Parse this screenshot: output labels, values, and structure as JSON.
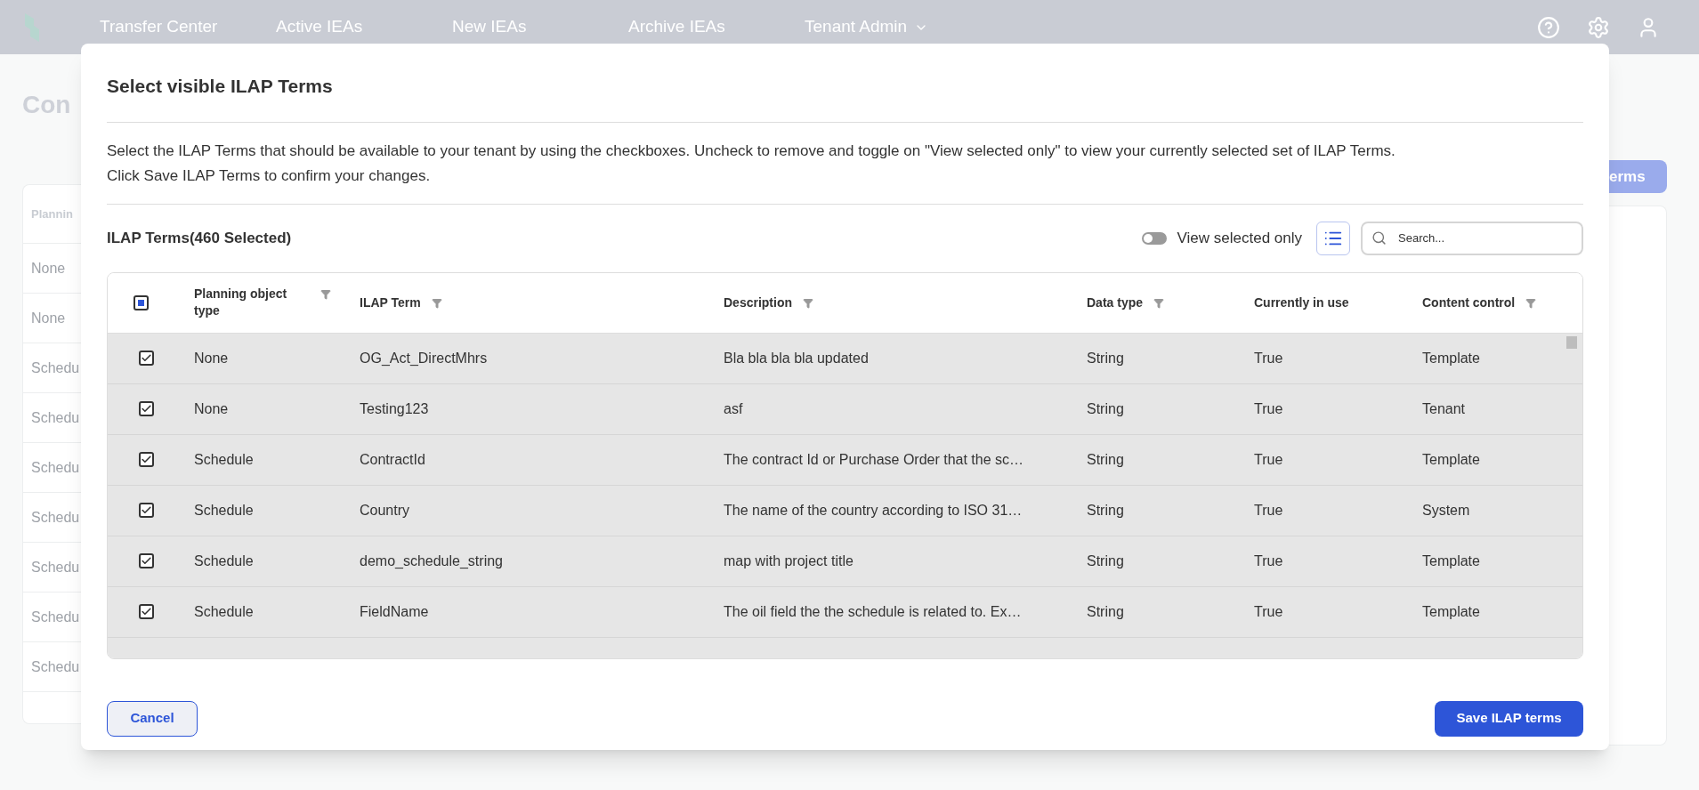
{
  "nav": {
    "items": [
      {
        "label": "Transfer Center",
        "dropdown": false
      },
      {
        "label": "Active IEAs",
        "dropdown": false
      },
      {
        "label": "New IEAs",
        "dropdown": false
      },
      {
        "label": "Archive IEAs",
        "dropdown": false
      },
      {
        "label": "Tenant Admin",
        "dropdown": true
      }
    ]
  },
  "background_page": {
    "title": "Con",
    "action_button": "erms",
    "table_header": "Plannin",
    "rows": [
      "None",
      "None",
      "Schedu",
      "Schedu",
      "Schedu",
      "Schedu",
      "Schedu",
      "Schedu",
      "Schedu"
    ]
  },
  "dialog": {
    "title": "Select visible ILAP Terms",
    "description": "Select the ILAP Terms that should be available to your tenant by using the checkboxes. Uncheck to remove and toggle on \"View selected only\" to view your currently selected set of ILAP Terms. Click Save ILAP Terms to confirm your changes.",
    "table_title": "ILAP Terms(460 Selected)",
    "view_selected_only": {
      "label": "View selected only",
      "on": false
    },
    "search": {
      "placeholder": "Search..."
    },
    "table": {
      "select_all": {
        "indeterminate": true
      },
      "columns": [
        {
          "label": "Planning object type",
          "filterable": true
        },
        {
          "label": "ILAP Term",
          "filterable": true
        },
        {
          "label": "Description",
          "filterable": true
        },
        {
          "label": "Data type",
          "filterable": true
        },
        {
          "label": "Currently in use",
          "filterable": false
        },
        {
          "label": "Content control",
          "filterable": true
        }
      ],
      "rows": [
        {
          "checked": true,
          "cells": [
            "None",
            "OG_Act_DirectMhrs",
            "Bla bla bla bla updated",
            "String",
            "True",
            "Template"
          ]
        },
        {
          "checked": true,
          "cells": [
            "None",
            "Testing123",
            "asf",
            "String",
            "True",
            "Tenant"
          ]
        },
        {
          "checked": true,
          "cells": [
            "Schedule",
            "ContractId",
            "The contract Id or Purchase Order that the sc…",
            "String",
            "True",
            "Template"
          ]
        },
        {
          "checked": true,
          "cells": [
            "Schedule",
            "Country",
            "The name of the country according to ISO 31…",
            "String",
            "True",
            "System"
          ]
        },
        {
          "checked": true,
          "cells": [
            "Schedule",
            "demo_schedule_string",
            "map with project title",
            "String",
            "True",
            "Template"
          ]
        },
        {
          "checked": true,
          "cells": [
            "Schedule",
            "FieldName",
            "The oil field the the schedule is related to. Ex…",
            "String",
            "True",
            "Template"
          ]
        }
      ]
    },
    "buttons": {
      "cancel": "Cancel",
      "save": "Save ILAP terms"
    }
  }
}
